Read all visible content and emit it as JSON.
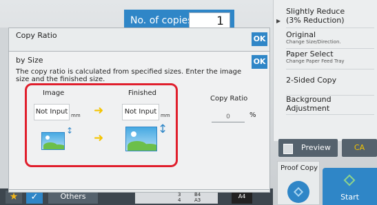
{
  "header": {
    "copies_label": "No. of copies",
    "copies_value": "1"
  },
  "right_menu": {
    "items": [
      {
        "title": "Slightly Reduce",
        "sub": "(3% Reduction)"
      },
      {
        "title": "Original",
        "sub": "Change Size/Direction."
      },
      {
        "title": "Paper Select",
        "sub": "Change Paper Feed Tray"
      },
      {
        "title": "2-Sided Copy",
        "sub": ""
      },
      {
        "title": "Background Adjustment",
        "sub": ""
      }
    ]
  },
  "actions": {
    "preview": "Preview",
    "ca": "CA",
    "proof_copy": "Proof Copy",
    "start": "Start"
  },
  "bottom": {
    "others": "Others",
    "tray_1": "3",
    "tray_1_size": "B4",
    "tray_2": "4",
    "tray_2_size": "A3",
    "paper_size": "A4"
  },
  "dialog_back": {
    "title": "Copy Ratio",
    "ok": "OK"
  },
  "dialog_front": {
    "title": "by Size",
    "ok": "OK",
    "description": "The copy ratio is calculated from specified sizes. Enter the image size and the finished size.",
    "image_label": "Image",
    "finished_label": "Finished",
    "image_value": "Not Input",
    "finished_value": "Not Input",
    "unit": "mm",
    "copy_ratio_label": "Copy Ratio",
    "copy_ratio_value": "0",
    "copy_ratio_unit": "%"
  },
  "colors": {
    "accent": "#2f86c7",
    "highlight": "#e01e2c",
    "arrow": "#f4c400"
  }
}
